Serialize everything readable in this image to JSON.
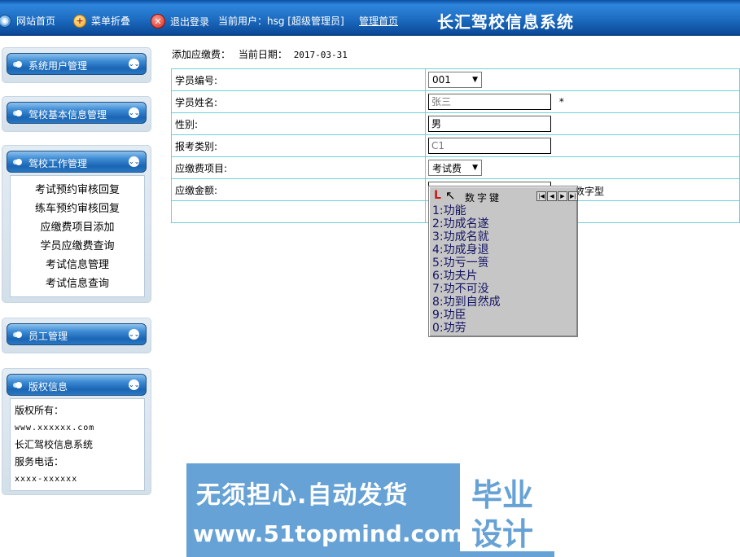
{
  "topbar": {
    "home": "网站首页",
    "menu_fold": "菜单折叠",
    "logout": "退出登录",
    "current_user": "当前用户：hsg [超级管理员]",
    "admin_home": "管理首页",
    "system_title": "长汇驾校信息系统"
  },
  "sidebar": {
    "panels": [
      {
        "title": "系统用户管理"
      },
      {
        "title": "驾校基本信息管理"
      },
      {
        "title": "驾校工作管理",
        "items": [
          "考试预约审核回复",
          "练车预约审核回复",
          "应缴费项目添加",
          "学员应缴费查询",
          "考试信息管理",
          "考试信息查询"
        ]
      },
      {
        "title": "员工管理"
      },
      {
        "title": "版权信息",
        "lines": [
          "版权所有：",
          "www.xxxxxx.com",
          "长汇驾校信息系统",
          "服务电话：",
          "xxxx-xxxxxx"
        ]
      }
    ]
  },
  "main": {
    "heading": "添加应缴费：",
    "date_label": "当前日期：",
    "date": "2017-03-31",
    "form": {
      "student_no_label": "学员编号:",
      "student_no_value": "001",
      "student_name_label": "学员姓名:",
      "student_name_value": "张三",
      "required_mark": "*",
      "gender_label": "性别:",
      "gender_value": "男",
      "category_label": "报考类别:",
      "category_value": "C1",
      "fee_item_label": "应缴费项目:",
      "fee_item_value": "考试费",
      "amount_label": "应缴金额:",
      "amount_hint": "数字型"
    }
  },
  "ime": {
    "logo": "L",
    "title": "数字键",
    "candidates": [
      "1:功能",
      "2:功成名遂",
      "3:功成名就",
      "4:功成身退",
      "5:功亏一篑",
      "6:功夫片",
      "7:功不可没",
      "8:功到自然成",
      "9:功臣",
      "0:功劳"
    ]
  },
  "watermark": {
    "slogan": "无须担心.自动发货",
    "url": "www.51topmind.com",
    "box_line1": "毕业",
    "box_line2": "设计"
  }
}
